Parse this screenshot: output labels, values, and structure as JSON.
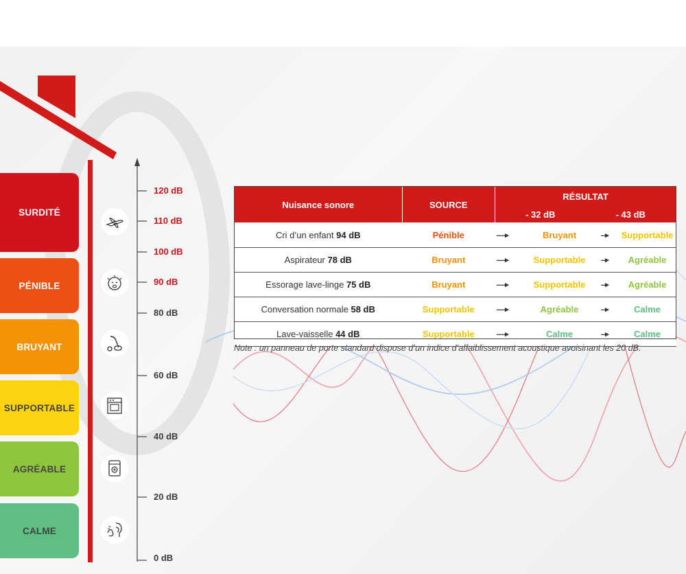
{
  "colors": {
    "red": "#d11a1a",
    "surdite": "#d0141d",
    "penible": "#ea5112",
    "bruyant": "#f39205",
    "supportable": "#fdd30f",
    "agreable": "#8fc53b",
    "calme": "#5fbe84"
  },
  "levels": [
    {
      "label": "SURDITÉ",
      "color": "#d0141d",
      "text_color": "#ffffff"
    },
    {
      "label": "PÉNIBLE",
      "color": "#ea5112",
      "text_color": "#ffffff"
    },
    {
      "label": "BRUYANT",
      "color": "#f39205",
      "text_color": "#ffffff"
    },
    {
      "label": "SUPPORTABLE",
      "color": "#fdd30f",
      "text_color": "#444444"
    },
    {
      "label": "AGRÉABLE",
      "color": "#8fc53b",
      "text_color": "#444444"
    },
    {
      "label": "CALME",
      "color": "#5fbe84",
      "text_color": "#444444"
    }
  ],
  "scale": {
    "ticks": [
      "120 dB",
      "110 dB",
      "100 dB",
      "90 dB",
      "80 dB",
      "60 dB",
      "40 dB",
      "20 dB",
      "0 dB"
    ],
    "icons": [
      "airplane-icon",
      "crying-baby-icon",
      "vacuum-cleaner-icon",
      "washing-machine-icon",
      "dishwasher-icon",
      "speaking-person-icon"
    ]
  },
  "table": {
    "header": {
      "nuisance": "Nuisance sonore",
      "source": "SOURCE",
      "resultat": "RÉSULTAT",
      "minus32": "- 32 dB",
      "minus43": "- 43 dB"
    },
    "arrow": "----▸",
    "arrow2": "--▸",
    "rows": [
      {
        "name": "Cri d’un enfant",
        "db": "94 dB",
        "source": "Pénible",
        "r32": "Bruyant",
        "r43": "Supportable"
      },
      {
        "name": "Aspirateur",
        "db": "78 dB",
        "source": "Bruyant",
        "r32": "Supportable",
        "r43": "Agréable"
      },
      {
        "name": "Essorage lave-linge",
        "db": "75 dB",
        "source": "Bruyant",
        "r32": "Supportable",
        "r43": "Agréable"
      },
      {
        "name": "Conversation normale",
        "db": "58 dB",
        "source": "Supportable",
        "r32": "Agréable",
        "r43": "Calme"
      },
      {
        "name": "Lave-vaisselle",
        "db": "44 dB",
        "source": "Supportable",
        "r32": "Calme",
        "r43": "Calme"
      }
    ]
  },
  "note": "Note : un panneau de porte standard dispose d’un indice d’affaiblissement acoustique avoisinant les 20 dB."
}
